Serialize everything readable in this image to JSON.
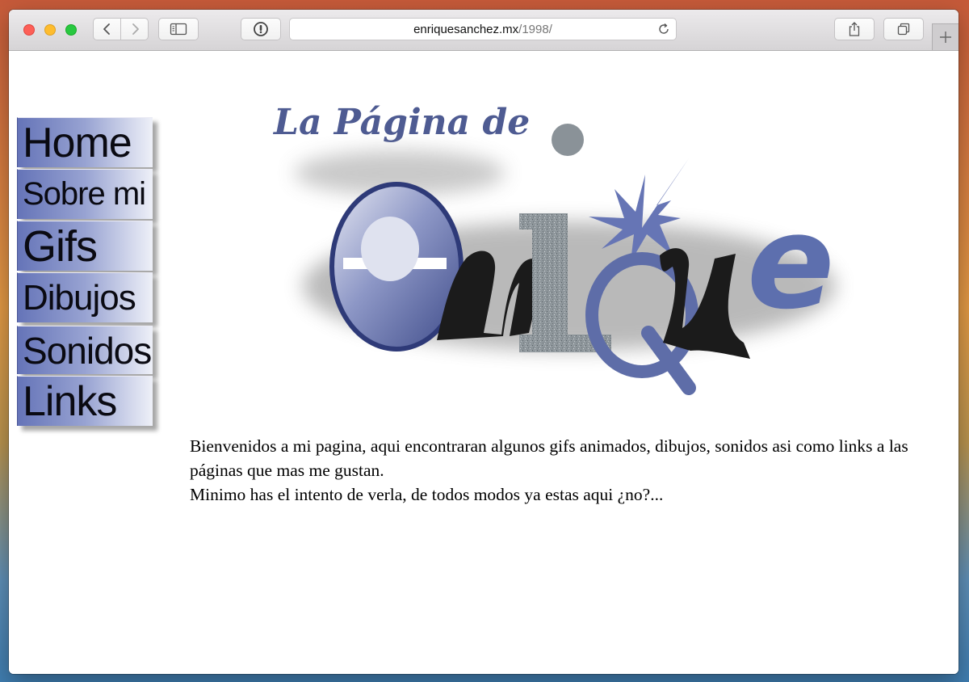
{
  "browser": {
    "url_host": "enriquesanchez.mx",
    "url_path": "/1998/",
    "icons": [
      "back-icon",
      "forward-icon",
      "sidebar-icon",
      "password-icon",
      "reload-icon",
      "share-icon",
      "tabs-icon",
      "plus-icon"
    ]
  },
  "page": {
    "logo": {
      "header_text": "La Página de",
      "word": "enrique"
    },
    "nav": [
      {
        "label": "Home"
      },
      {
        "label": "Sobre mi"
      },
      {
        "label": "Gifs"
      },
      {
        "label": "Dibujos"
      },
      {
        "label": "Sonidos"
      },
      {
        "label": "Links"
      }
    ],
    "intro": {
      "line1": "Bienvenidos a mi pagina, aqui encontraran algunos gifs animados, dibujos, sonidos  asi como links a las páginas que mas me gustan.",
      "line2": "Minimo has el intento de verla, de todos modos ya estas aqui ¿no?..."
    }
  },
  "colors": {
    "nav_blue": "#6574b8",
    "logo_blue": "#5d6fae",
    "logo_dark": "#1a1a1a"
  }
}
